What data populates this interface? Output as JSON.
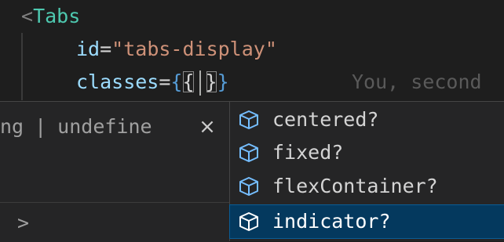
{
  "code": {
    "line1": {
      "bracket": "<",
      "tag": "Tabs"
    },
    "line2": {
      "attr": "id",
      "eq": "=",
      "value": "\"tabs-display\""
    },
    "line3": {
      "attr": "classes",
      "eq": "=",
      "brace_open": "{",
      "inner_open": "{",
      "inner_close": "}",
      "brace_close": "}"
    },
    "ghost_text": "You, second"
  },
  "hover": {
    "left_text": "ng",
    "separator": "|",
    "right_text": "undefine",
    "close_symbol": "×",
    "chevron": ">"
  },
  "suggestions": {
    "items": [
      {
        "label": "centered?",
        "icon": "cube-icon",
        "selected": false
      },
      {
        "label": "fixed?",
        "icon": "cube-icon",
        "selected": false
      },
      {
        "label": "flexContainer?",
        "icon": "cube-icon",
        "selected": false
      },
      {
        "label": "indicator?",
        "icon": "cube-icon",
        "selected": true
      }
    ]
  },
  "colors": {
    "background": "#1e1e1e",
    "tag": "#4ec9b0",
    "attribute": "#9cdcfe",
    "string": "#ce9178",
    "brace": "#569cd6",
    "icon": "#75beff",
    "selected_row": "#04395e"
  }
}
